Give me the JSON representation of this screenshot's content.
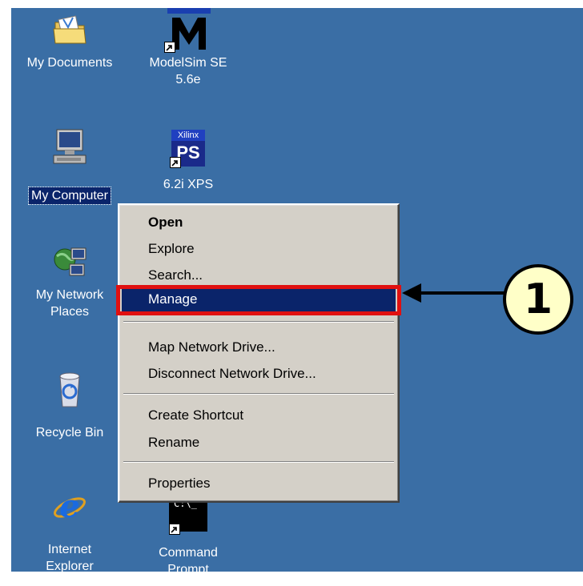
{
  "desktop": {
    "icons": [
      {
        "name": "My Documents",
        "icon": "folder-icon"
      },
      {
        "name": "ModelSim SE 5.6e",
        "icon": "modelsim-icon",
        "line1": "ModelSim SE",
        "line2": "5.6e",
        "logo_text": "M"
      },
      {
        "name": "My Computer",
        "icon": "computer-icon",
        "selected": true
      },
      {
        "name": "6.2i XPS",
        "icon": "xilinx-icon",
        "logo_top": "Xilinx",
        "logo_bottom": "PS"
      },
      {
        "name": "My Network Places",
        "icon": "network-icon",
        "line1": "My Network",
        "line2": "Places"
      },
      {
        "name": "Recycle Bin",
        "icon": "recycle-bin-icon"
      },
      {
        "name": "Internet Explorer",
        "icon": "ie-icon",
        "line1": "Internet",
        "line2": "Explorer"
      },
      {
        "name": "Command Prompt",
        "icon": "cmd-icon",
        "line1": "Command",
        "line2": "Prompt",
        "logo_text": "C:\\_"
      }
    ]
  },
  "context_menu": {
    "items": [
      "Open",
      "Explore",
      "Search...",
      "Manage",
      "Map Network Drive...",
      "Disconnect Network Drive...",
      "Create Shortcut",
      "Rename",
      "Properties"
    ],
    "default_item": "Open",
    "highlighted_item": "Manage"
  },
  "annotation": {
    "callout_number": "1",
    "highlight_color": "#e01010"
  },
  "colors": {
    "desktop": "#3a6ea5",
    "menu": "#d4d0c8",
    "selection": "#0a246a"
  }
}
